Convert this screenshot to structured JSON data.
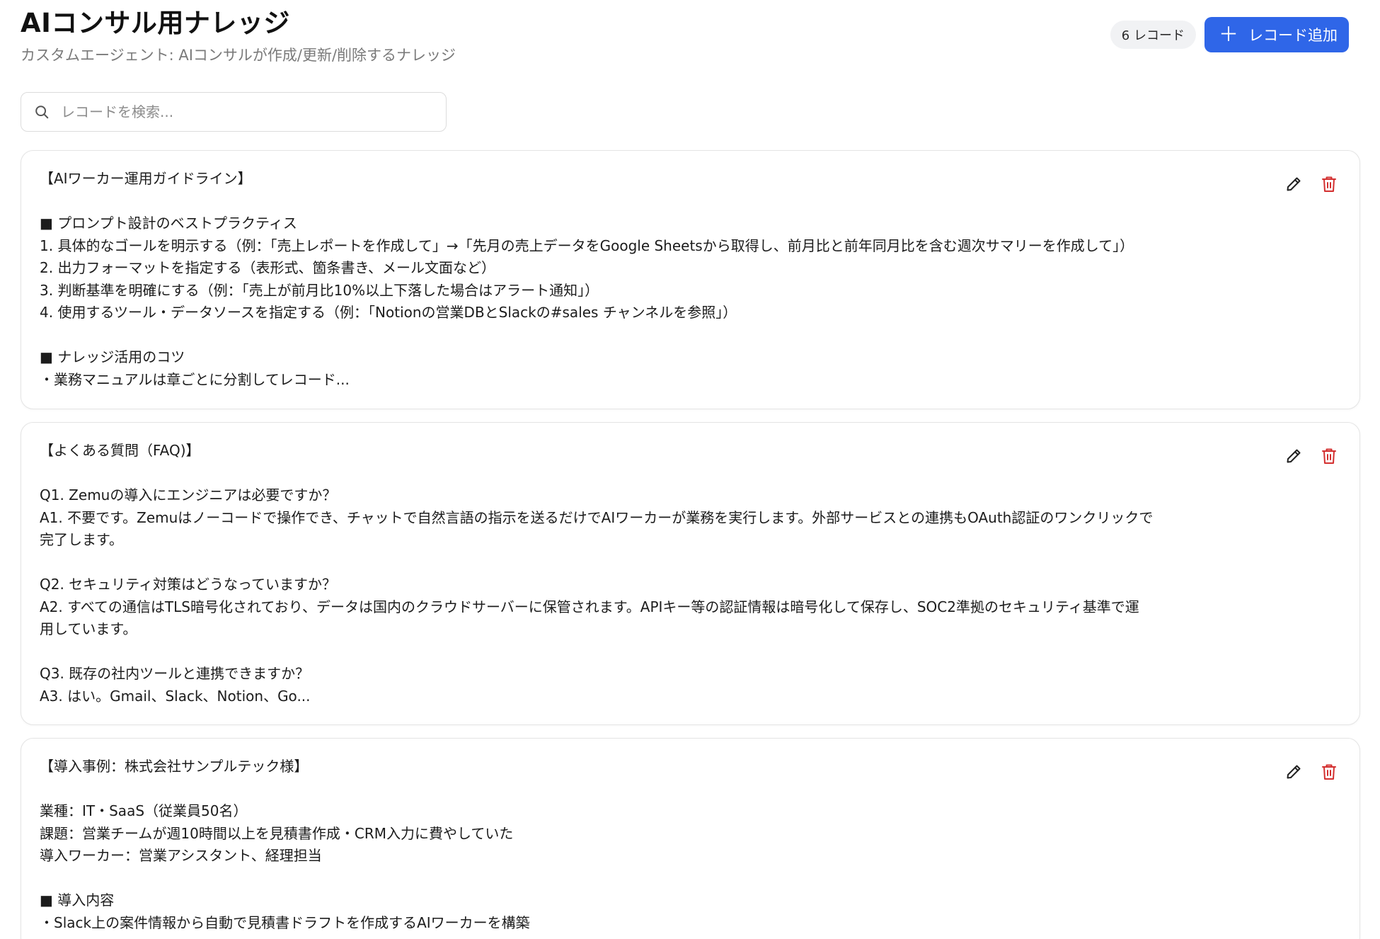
{
  "header": {
    "title": "AIコンサル用ナレッジ",
    "subtitle": "カスタムエージェント: AIコンサルが作成/更新/削除するナレッジ",
    "record_count": "6 レコード",
    "add_label": "レコード追加",
    "add_icon": "plus-icon"
  },
  "search": {
    "placeholder": "レコードを検索...",
    "value": "",
    "icon": "search-icon"
  },
  "records": [
    {
      "lines": [
        "【AIワーカー運用ガイドライン】",
        "",
        "■ プロンプト設計のベストプラクティス",
        "1. 具体的なゴールを明示する（例：「売上レポートを作成して」→「先月の売上データをGoogle Sheetsから取得し、前月比と前年同月比を含む週次サマリーを作成して」）",
        "2. 出力フォーマットを指定する（表形式、箇条書き、メール文面など）",
        "3. 判断基準を明確にする（例：「売上が前月比10%以上下落した場合はアラート通知」）",
        "4. 使用するツール・データソースを指定する（例：「Notionの営業DBとSlackの#sales チャンネルを参照」）",
        "",
        "■ ナレッジ活用のコツ",
        "・業務マニュアルは章ごとに分割してレコード..."
      ],
      "edit_icon": "pencil-icon",
      "delete_icon": "trash-icon"
    },
    {
      "lines": [
        "【よくある質問（FAQ)】",
        "",
        "Q1. Zemuの導入にエンジニアは必要ですか？",
        "A1. 不要です。Zemuはノーコードで操作でき、チャットで自然言語の指示を送るだけでAIワーカーが業務を実行します。外部サービスとの連携もOAuth認証のワンクリックで",
        "完了します。",
        "",
        "Q2. セキュリティ対策はどうなっていますか？",
        "A2. すべての通信はTLS暗号化されており、データは国内のクラウドサーバーに保管されます。APIキー等の認証情報は暗号化して保存し、SOC2準拠のセキュリティ基準で運",
        "用しています。",
        "",
        "Q3. 既存の社内ツールと連携できますか？",
        "A3. はい。Gmail、Slack、Notion、Go..."
      ],
      "edit_icon": "pencil-icon",
      "delete_icon": "trash-icon"
    },
    {
      "lines": [
        "【導入事例：株式会社サンプルテック様】",
        "",
        "業種：IT・SaaS（従業員50名）",
        "課題：営業チームが週10時間以上を見積書作成・CRM入力に費やしていた",
        "導入ワーカー：営業アシスタント、経理担当",
        "",
        "■ 導入内容",
        "・Slack上の案件情報から自動で見積書ドラフトを作成するAIワーカーを構築"
      ],
      "edit_icon": "pencil-icon",
      "delete_icon": "trash-icon"
    }
  ],
  "colors": {
    "primary": "#2f66e8",
    "delete": "#d32f2f",
    "subtitle": "#7a7a7a"
  }
}
